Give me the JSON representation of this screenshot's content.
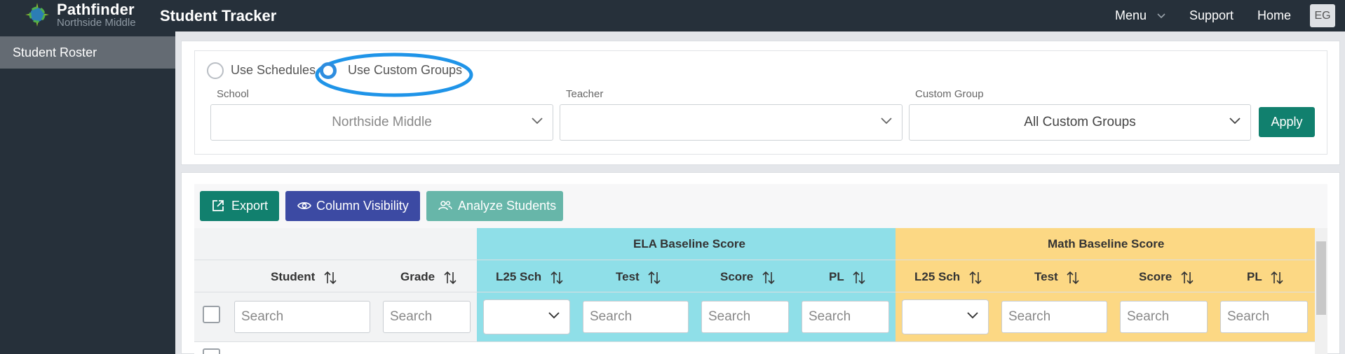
{
  "header": {
    "brand_name": "Pathfinder",
    "brand_sub": "Northside Middle",
    "app_title": "Student Tracker",
    "nav": {
      "menu": "Menu",
      "support": "Support",
      "home": "Home"
    },
    "avatar": "EG"
  },
  "sidebar": {
    "items": [
      {
        "label": "Student Roster"
      }
    ]
  },
  "filters": {
    "mode_schedules": "Use Schedules",
    "mode_custom_groups": "Use Custom Groups",
    "selected_mode": "Use Custom Groups",
    "school_label": "School",
    "school_value": "Northside Middle",
    "teacher_label": "Teacher",
    "teacher_value": "",
    "group_label": "Custom Group",
    "group_value": "All Custom Groups",
    "apply": "Apply"
  },
  "toolbar": {
    "export": "Export",
    "column_visibility": "Column Visibility",
    "analyze": "Analyze Students"
  },
  "table": {
    "groups": {
      "ela": "ELA Baseline Score",
      "math": "Math Baseline Score"
    },
    "columns": {
      "student": "Student",
      "grade": "Grade",
      "ela_l25": "L25 Sch",
      "ela_test": "Test",
      "ela_score": "Score",
      "ela_pl": "PL",
      "math_l25": "L25 Sch",
      "math_test": "Test",
      "math_score": "Score",
      "math_pl": "PL"
    },
    "search_placeholder": "Search"
  },
  "colors": {
    "topbar": "#26303a",
    "accent_teal": "#11806e",
    "accent_indigo": "#3c4aa3",
    "accent_teal_light": "#67b6a9",
    "ela_band": "#8fdfe8",
    "math_band": "#fcd884",
    "radio_selected": "#2e8ddf"
  }
}
